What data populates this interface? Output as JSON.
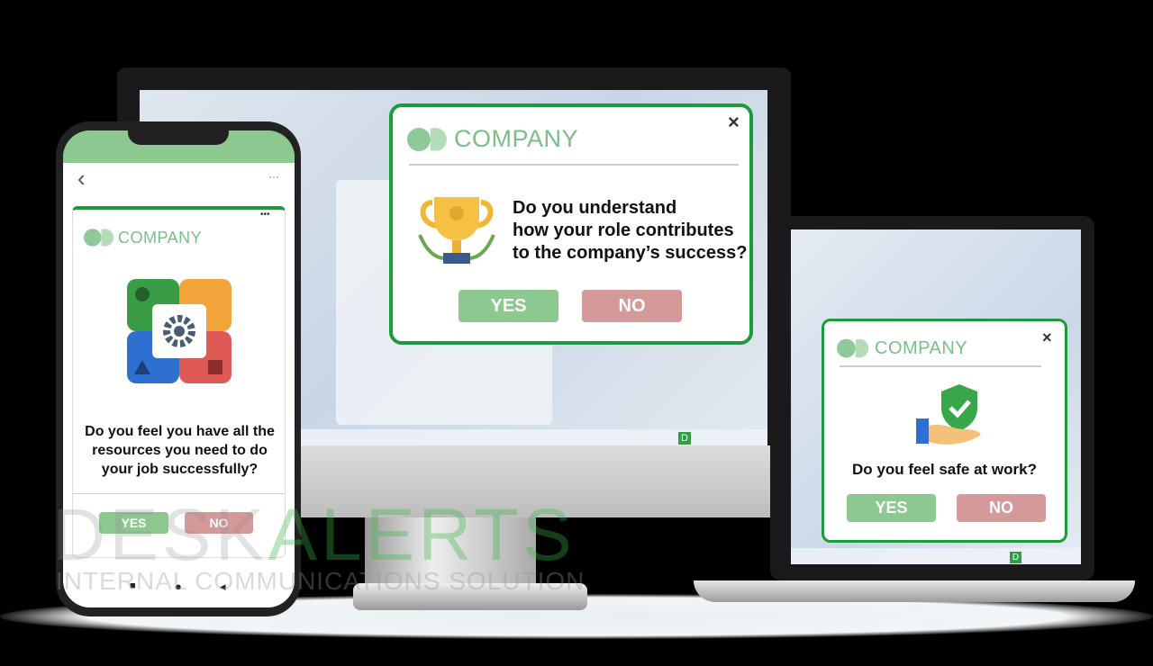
{
  "monitor_popup": {
    "company": "COMPANY",
    "question_lines": [
      "Do you understand",
      "how your role contributes",
      "to the company’s success?"
    ],
    "yes": "YES",
    "no": "NO",
    "close": "×",
    "icon": "trophy-icon"
  },
  "laptop_popup": {
    "company": "COMPANY",
    "question": "Do you feel safe at work?",
    "yes": "YES",
    "no": "NO",
    "close": "×",
    "icon": "shield-check-hand-icon"
  },
  "phone": {
    "back": "‹",
    "menu": "···",
    "card_menu": "•••",
    "company": "COMPANY",
    "question": "Do you feel you have all the resources you need to do your job successfully?",
    "yes": "YES",
    "no": "NO",
    "icon": "gear-puzzle-icon",
    "nav": [
      "■",
      "●",
      "◂"
    ]
  },
  "desktop": {
    "taskbar_badge": "D"
  },
  "watermark": {
    "brand_a": "DESK",
    "brand_b": "ALERTS",
    "tagline": "INTERNAL COMMUNICATIONS SOLUTION"
  },
  "colors": {
    "border_green": "#1d9a3c",
    "yes": "#8dc890",
    "no": "#d49a9a",
    "logo": "#7cbf86"
  }
}
